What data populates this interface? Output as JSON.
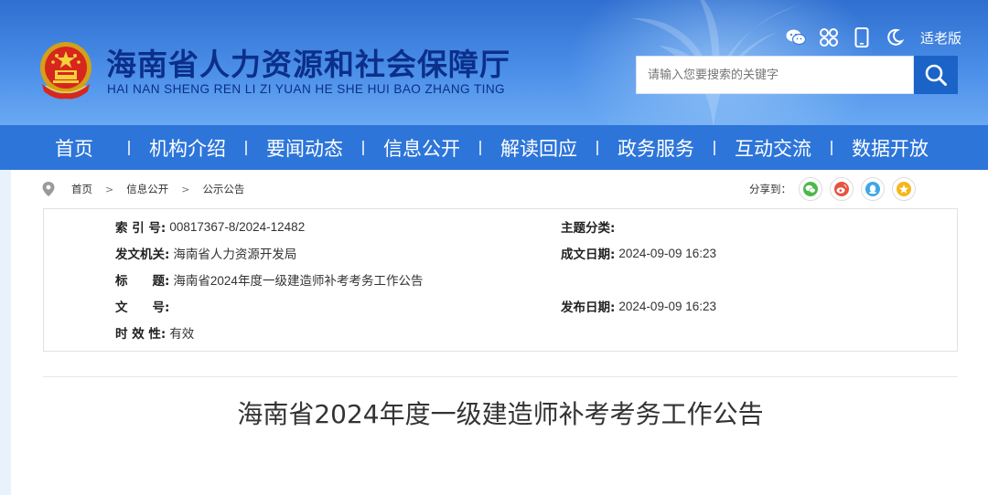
{
  "header": {
    "site_title": "海南省人力资源和社会保障厅",
    "site_subtitle": "HAI NAN SHENG REN LI ZI YUAN HE SHE HUI BAO ZHANG TING",
    "tools": [
      {
        "icon": "wechat-icon"
      },
      {
        "icon": "mini-program-icon"
      },
      {
        "icon": "mobile-icon"
      },
      {
        "icon": "moon-icon"
      }
    ],
    "elder_mode_label": "适老版",
    "search_placeholder": "请输入您要搜索的关键字",
    "search_icon": "search-icon"
  },
  "nav": {
    "items": [
      "首页",
      "机构介绍",
      "要闻动态",
      "信息公开",
      "解读回应",
      "政务服务",
      "互动交流",
      "数据开放"
    ]
  },
  "breadcrumb": {
    "items": [
      "首页",
      "信息公开",
      "公示公告"
    ]
  },
  "share": {
    "label": "分享到：",
    "targets": [
      "wechat-share-icon",
      "weibo-share-icon",
      "qq-share-icon",
      "qzone-share-icon"
    ]
  },
  "info": {
    "index_no_label": "索 引 号:",
    "index_no": "00817367-8/2024-12482",
    "topic_label": "主题分类:",
    "topic": "",
    "issuer_label": "发文机关:",
    "issuer": "海南省人力资源开发局",
    "created_label": "成文日期:",
    "created": "2024-09-09 16:23",
    "title_label": "标　　题:",
    "title": "海南省2024年度一级建造师补考考务工作公告",
    "doc_no_label": "文　　号:",
    "doc_no": "",
    "published_label": "发布日期:",
    "published": "2024-09-09 16:23",
    "validity_label": "时 效 性:",
    "validity": "有效"
  },
  "article": {
    "title": "海南省2024年度一级建造师补考考务工作公告"
  },
  "colors": {
    "header_blue": "#2f6fd0",
    "nav_blue": "#2d75d9",
    "title_navy": "#0b2f8a",
    "search_button": "#1c63c8"
  }
}
